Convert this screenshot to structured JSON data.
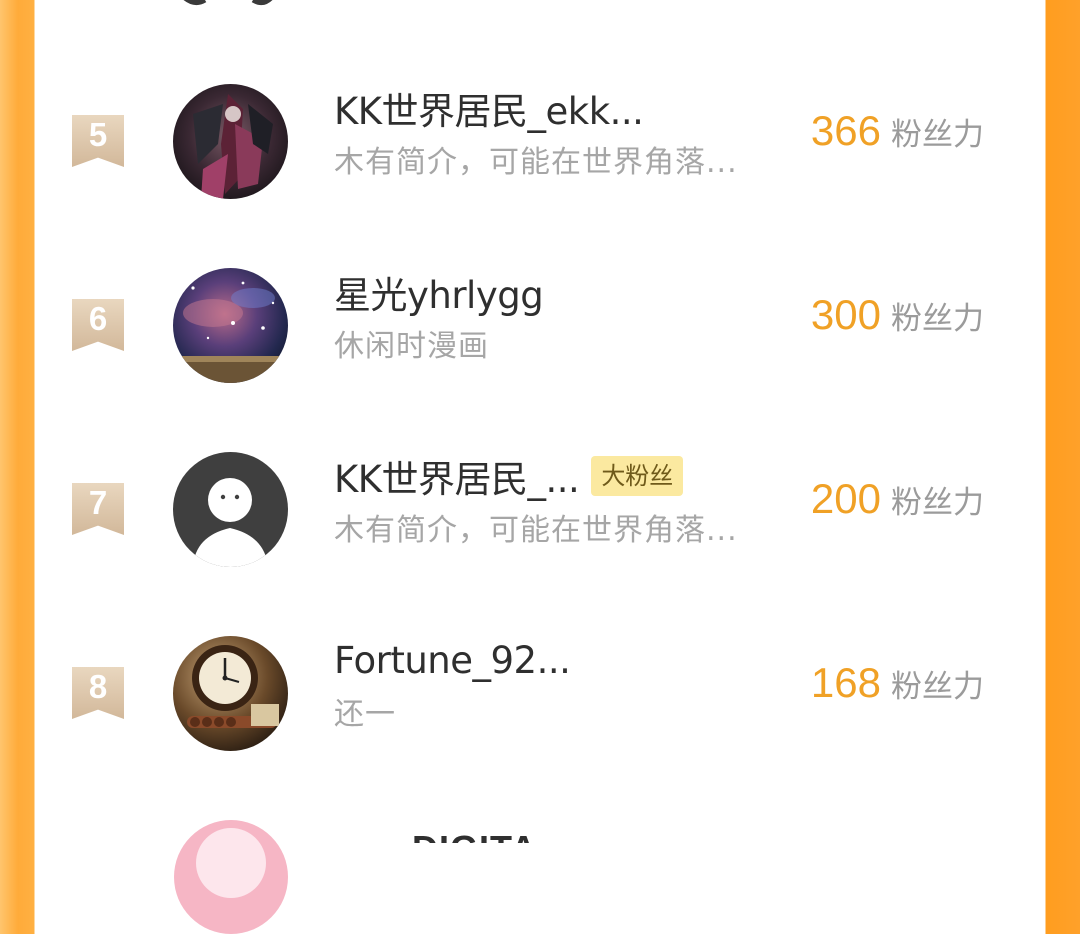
{
  "ranking": {
    "entries": [
      {
        "rank": "5",
        "name": "KK世界居民_ekk...",
        "intro": "木有简介，可能在世界角落...",
        "score": "366",
        "score_unit": "粉丝力",
        "avatar": "dark-fantasy-warrior-avatar"
      },
      {
        "rank": "6",
        "name": "星光yhrlygg",
        "intro": "休闲时漫画",
        "score": "300",
        "score_unit": "粉丝力",
        "avatar": "galaxy-nebula-avatar"
      },
      {
        "rank": "7",
        "name": "KK世界居民_...",
        "badge": "大粉丝",
        "intro": "木有简介，可能在世界角落...",
        "score": "200",
        "score_unit": "粉丝力",
        "avatar": "default-user-avatar"
      },
      {
        "rank": "8",
        "name": "Fortune_92...",
        "intro": "还一",
        "score": "168",
        "score_unit": "粉丝力",
        "avatar": "antique-clock-avatar"
      }
    ],
    "next_entry_partial_name": "DIGITA"
  },
  "colors": {
    "score": "#f0a126",
    "frame": "#ffa12a",
    "rank_badge": "#d2b89a",
    "fan_badge_bg": "#fbe9a0"
  }
}
